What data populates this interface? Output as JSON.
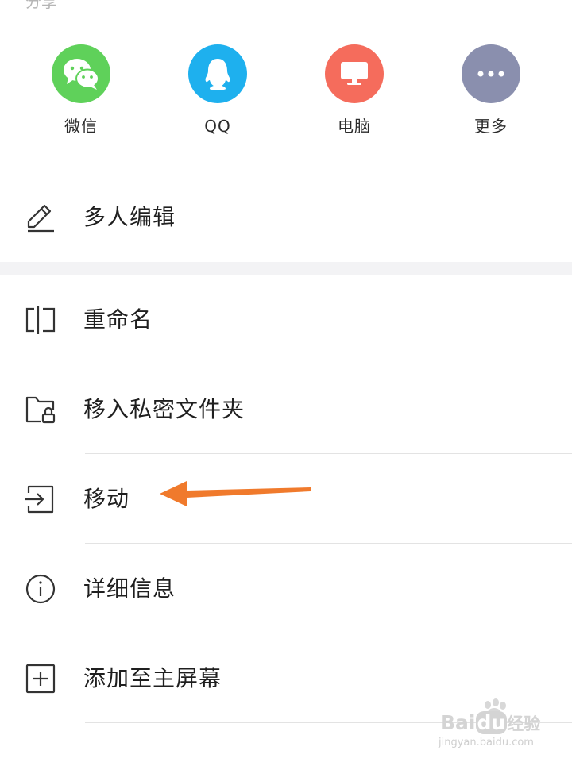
{
  "share": {
    "header": "分享",
    "items": [
      {
        "label": "微信",
        "icon": "wechat-icon",
        "color": "#5fd15a"
      },
      {
        "label": "QQ",
        "icon": "qq-icon",
        "color": "#1eb0ee"
      },
      {
        "label": "电脑",
        "icon": "computer-icon",
        "color": "#f56c5c"
      },
      {
        "label": "更多",
        "icon": "more-icon",
        "color": "#8a8fae"
      }
    ]
  },
  "menu": {
    "collab_edit": "多人编辑",
    "items": [
      {
        "label": "重命名",
        "icon": "rename-icon"
      },
      {
        "label": "移入私密文件夹",
        "icon": "private-folder-icon"
      },
      {
        "label": "移动",
        "icon": "move-icon"
      },
      {
        "label": "详细信息",
        "icon": "info-icon"
      },
      {
        "label": "添加至主屏幕",
        "icon": "add-to-home-icon"
      }
    ]
  },
  "annotation": {
    "arrow_color": "#f07a2c"
  },
  "watermark": {
    "brand": "Bai",
    "brand_suffix": "du",
    "product": "经验",
    "url": "jingyan.baidu.com"
  }
}
